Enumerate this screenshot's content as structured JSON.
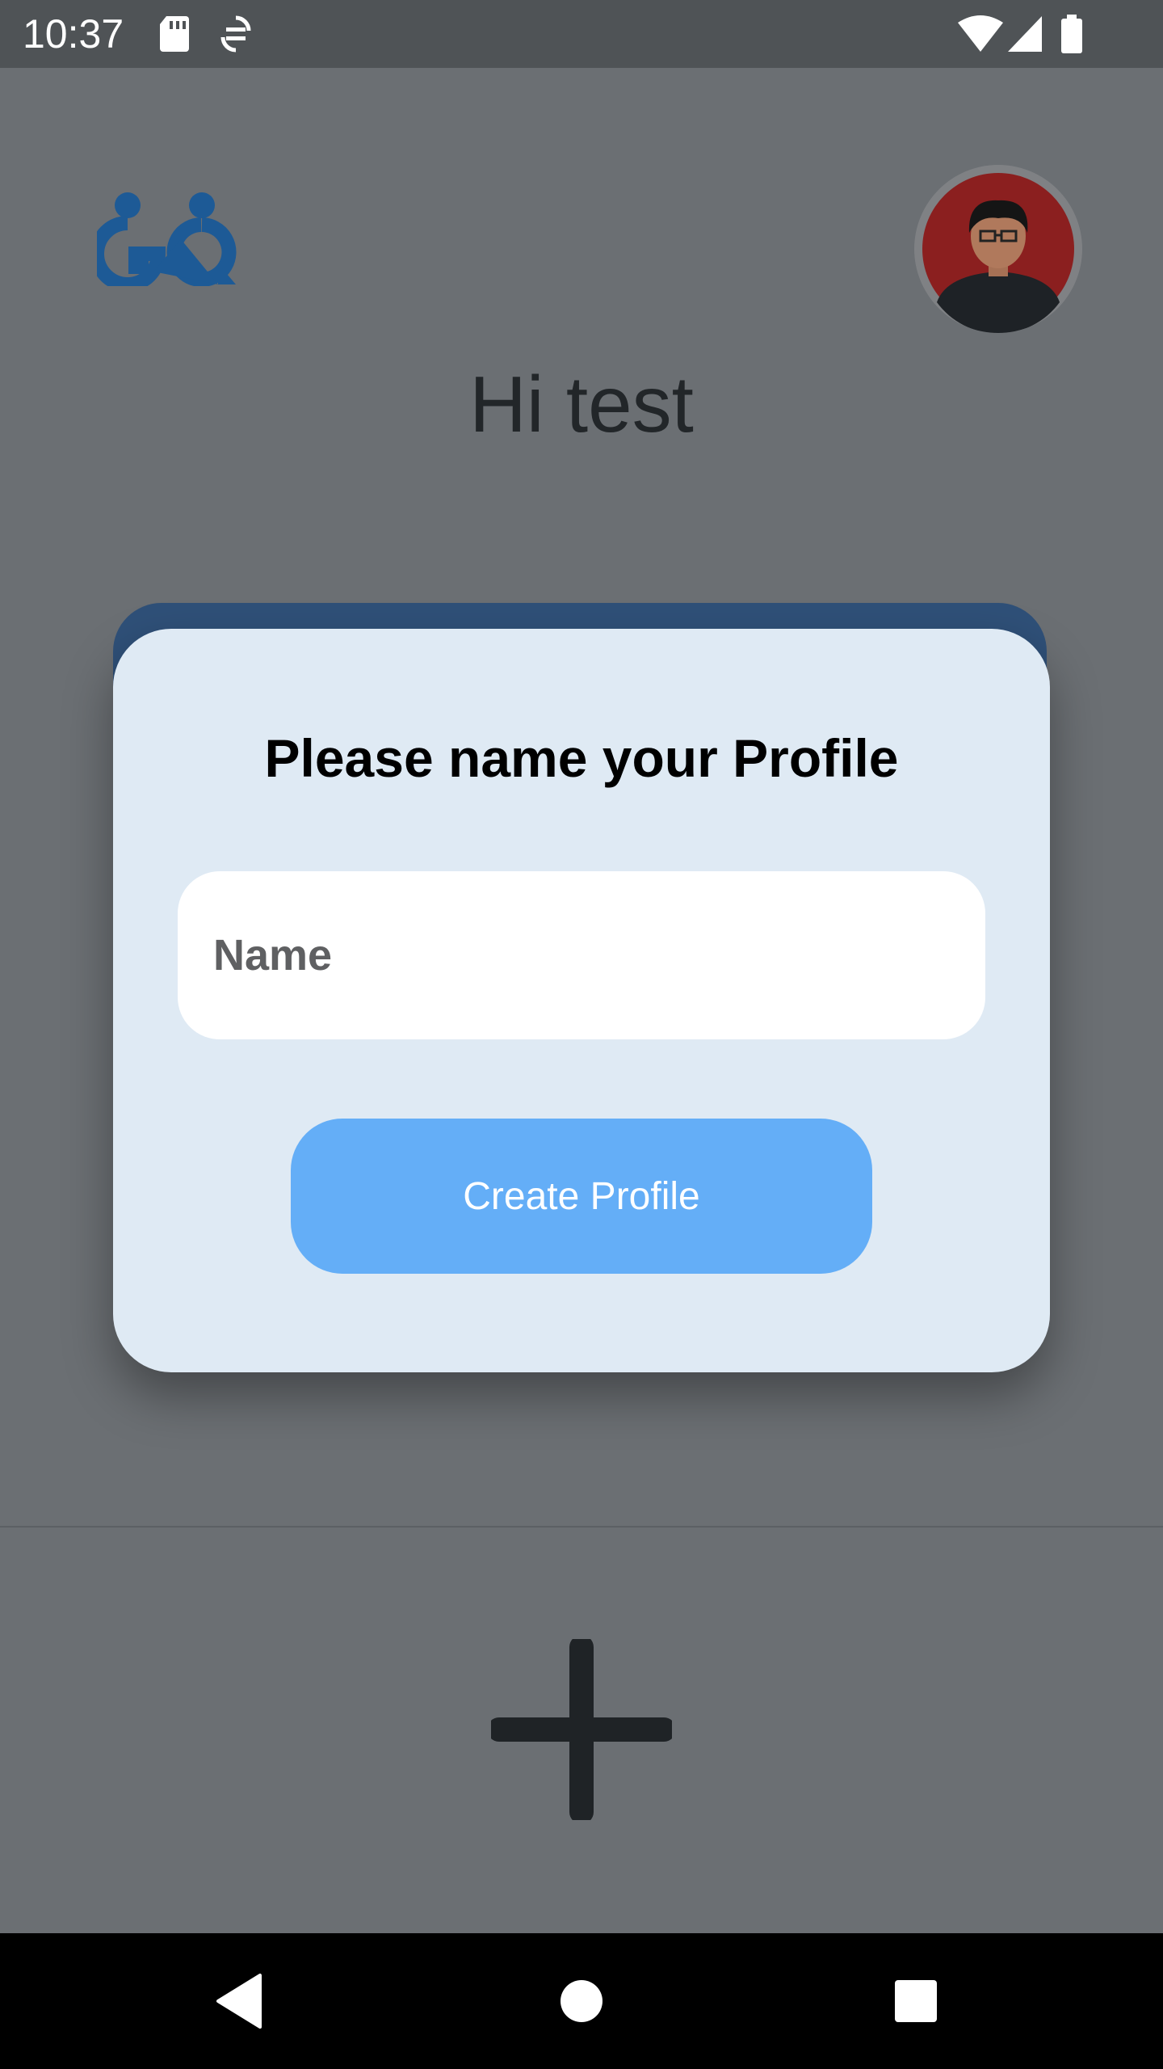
{
  "status_bar": {
    "time": "10:37",
    "left_icons": [
      "sd-card-icon",
      "sync-icon"
    ],
    "right_icons": [
      "wifi-icon",
      "cell-signal-icon",
      "battery-icon"
    ]
  },
  "header": {
    "logo_icon": "app-logo-icon",
    "avatar_icon": "user-avatar-icon",
    "greeting": "Hi test"
  },
  "dialog": {
    "title": "Please name your Profile",
    "name_field": {
      "value": "",
      "placeholder": "Name"
    },
    "create_button_label": "Create Profile",
    "colors": {
      "background": "#dfeaf4",
      "button": "#64aef7",
      "accent": "#2f5078"
    }
  },
  "fab": {
    "icon": "plus-icon"
  },
  "nav_bar": {
    "back_icon": "back-triangle-icon",
    "home_icon": "home-circle-icon",
    "recents_icon": "recents-square-icon"
  }
}
